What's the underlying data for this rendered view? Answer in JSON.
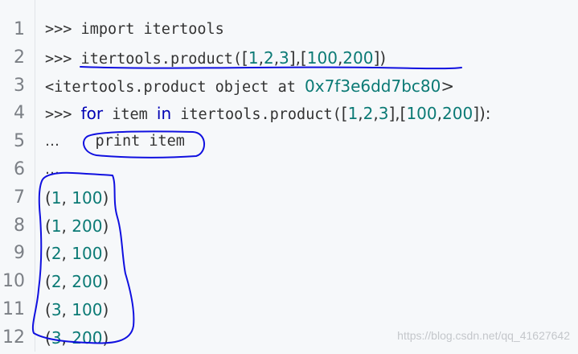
{
  "line_numbers": [
    "1",
    "2",
    "3",
    "4",
    "5",
    "6",
    "7",
    "8",
    "9",
    "10",
    "11",
    "12"
  ],
  "code": {
    "l1": {
      "prompt": ">>>",
      "text": " import itertools"
    },
    "l2": {
      "prompt": ">>>",
      "fn": " itertools.product(",
      "a": "[",
      "n1": "1",
      "c1": ",",
      "n2": "2",
      "c2": ",",
      "n3": "3",
      "b": "],[",
      "n4": "100",
      "c3": ",",
      "n5": "200",
      "e": "])"
    },
    "l3": {
      "text": "<itertools.product object at ",
      "addr": "0x7f3e6dd7bc80",
      "end": ">"
    },
    "l4": {
      "prompt": ">>>",
      "for": "for",
      "item": " item ",
      "in": "in",
      "call": " itertools.product(",
      "a": "[",
      "n1": "1",
      "c1": ",",
      "n2": "2",
      "c2": ",",
      "n3": "3",
      "b": "],[",
      "n4": "100",
      "c3": ",",
      "n5": "200",
      "e": "]):"
    },
    "l5": {
      "prompt": "…",
      "body": "    print item"
    },
    "l6": {
      "prompt": "…"
    },
    "out": [
      {
        "open": "(",
        "a": "1",
        "sep": ", ",
        "b": "100",
        "close": ")"
      },
      {
        "open": "(",
        "a": "1",
        "sep": ", ",
        "b": "200",
        "close": ")"
      },
      {
        "open": "(",
        "a": "2",
        "sep": ", ",
        "b": "100",
        "close": ")"
      },
      {
        "open": "(",
        "a": "2",
        "sep": ", ",
        "b": "200",
        "close": ")"
      },
      {
        "open": "(",
        "a": "3",
        "sep": ", ",
        "b": "100",
        "close": ")"
      },
      {
        "open": "(",
        "a": "3",
        "sep": ", ",
        "b": "200",
        "close": ")"
      }
    ]
  },
  "watermark": "https://blog.csdn.net/qq_41627642",
  "colors": {
    "number": "#0b7a75",
    "keyword": "#0000b4",
    "ink": "#1010e0"
  }
}
